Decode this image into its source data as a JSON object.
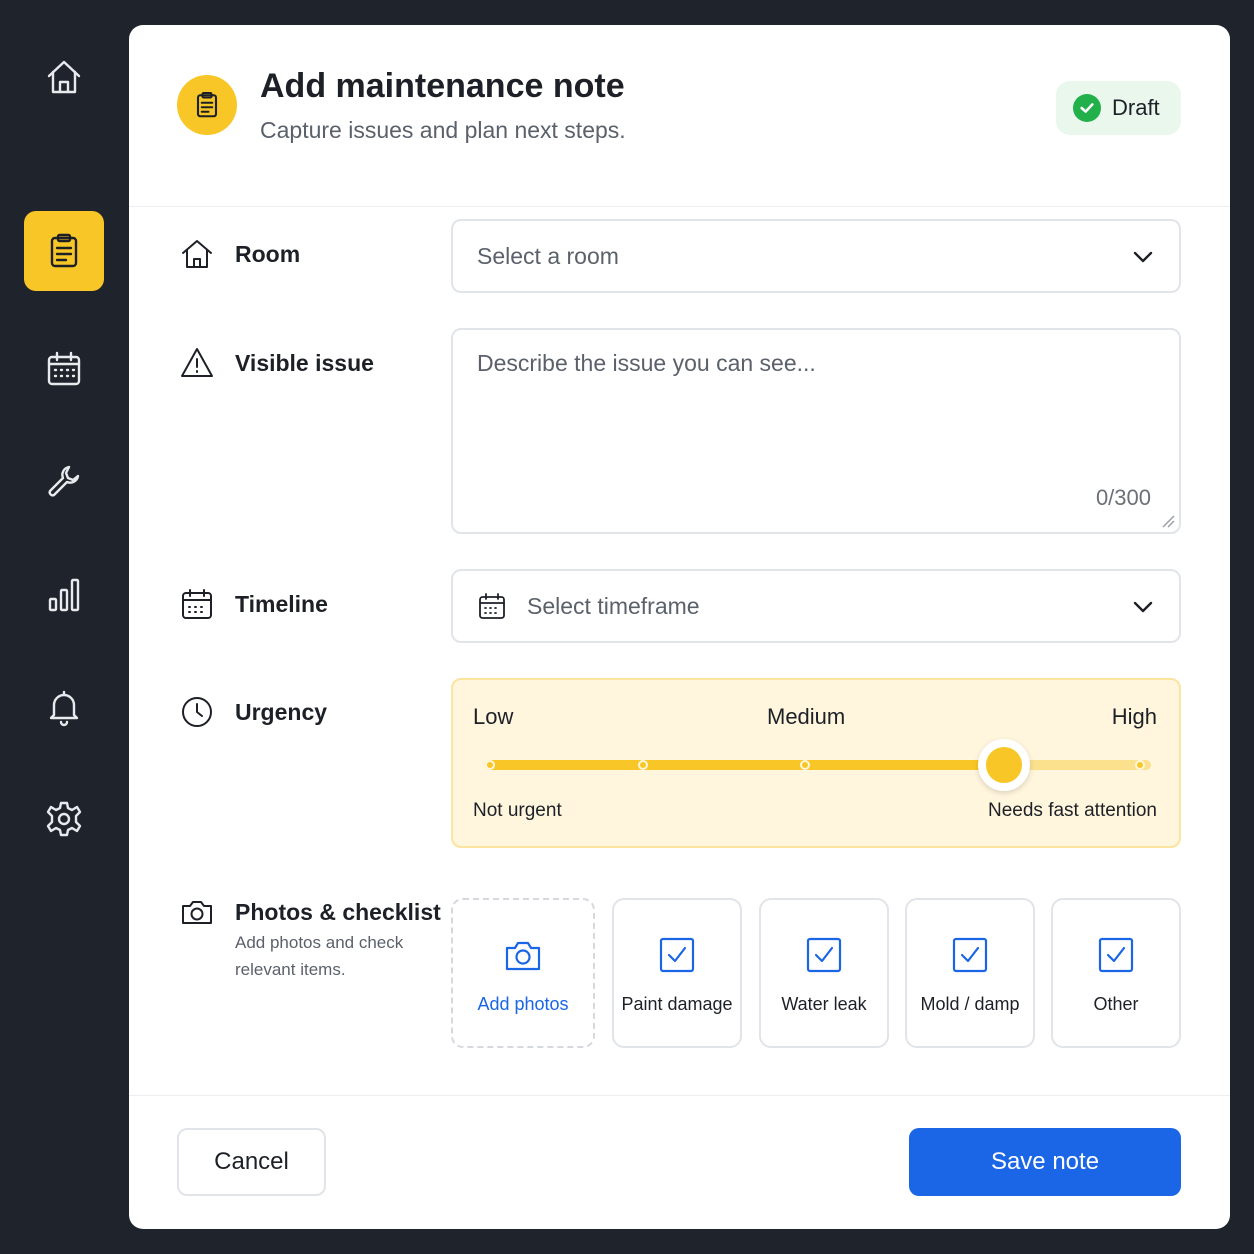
{
  "colors": {
    "background": "#1f242c",
    "accent": "#f8c727",
    "primary": "#1a66e6",
    "success": "#22b04b"
  },
  "sidebar": {
    "items": [
      {
        "icon": "home-icon",
        "active": false
      },
      {
        "icon": "clipboard-icon",
        "active": true
      },
      {
        "icon": "calendar-icon",
        "active": false
      },
      {
        "icon": "wrench-icon",
        "active": false
      },
      {
        "icon": "bar-chart-icon",
        "active": false
      },
      {
        "icon": "bell-icon",
        "active": false
      },
      {
        "icon": "gear-icon",
        "active": false
      }
    ]
  },
  "header": {
    "icon": "clipboard-icon",
    "title": "Add maintenance note",
    "subtitle": "Capture issues and plan next steps.",
    "status_badge": "Draft"
  },
  "form": {
    "room": {
      "label": "Room",
      "placeholder": "Select a room"
    },
    "issue": {
      "label": "Visible issue",
      "placeholder": "Describe the issue you can see...",
      "counter": "0/300"
    },
    "timeline": {
      "label": "Timeline",
      "placeholder": "Select timeframe"
    },
    "urgency": {
      "label": "Urgency",
      "low": "Low",
      "medium": "Medium",
      "high": "High",
      "min_caption": "Not urgent",
      "max_caption": "Needs fast attention",
      "value_fraction": 0.78
    },
    "photos": {
      "label": "Photos & checklist",
      "description": "Add photos and check relevant items.",
      "add_photos": "Add photos",
      "checklist": [
        "Paint damage",
        "Water leak",
        "Mold / damp",
        "Other"
      ]
    }
  },
  "footer": {
    "cancel": "Cancel",
    "save": "Save note"
  }
}
